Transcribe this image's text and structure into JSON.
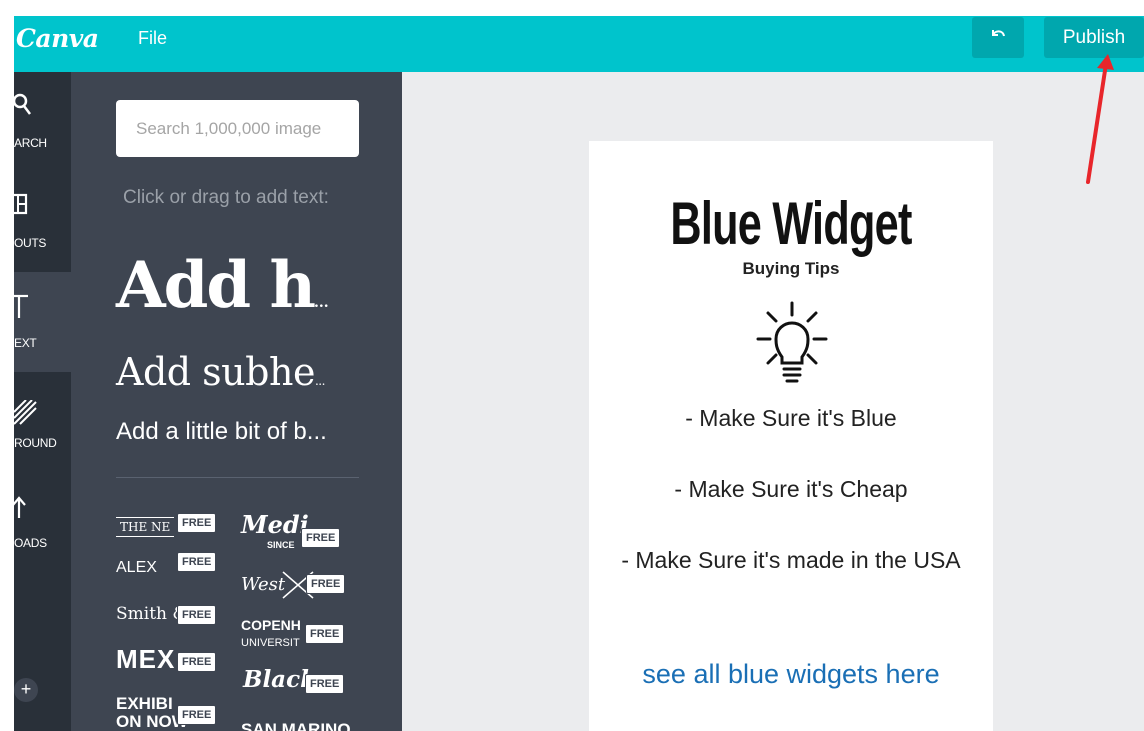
{
  "header": {
    "logo": "Canva",
    "file_menu": "File",
    "undo_icon": "undo-icon",
    "publish_label": "Publish"
  },
  "rail": {
    "items": [
      {
        "label": "ARCH",
        "icon": "search-icon"
      },
      {
        "label": "OUTS",
        "icon": "layouts-icon"
      },
      {
        "label": "EXT",
        "icon": "text-icon"
      },
      {
        "label": "ROUND",
        "icon": "background-icon"
      },
      {
        "label": "OADS",
        "icon": "upload-icon"
      }
    ],
    "active_index": 2,
    "plus_label": "+"
  },
  "panel": {
    "search_placeholder": "Search 1,000,000 image",
    "hint": "Click or drag to add text:",
    "add_heading": "Add h",
    "add_subheading": "Add subhe",
    "add_body": "Add a little bit of b...",
    "free_badge": "FREE",
    "templates": [
      "THE NE",
      "Medi",
      "SINCE",
      "ALEX",
      "West",
      "Smith &",
      "COPENH",
      "UNIVERSIT",
      "MEX",
      "Black",
      "EXHIBI",
      "ON NOW",
      "SAN MARINO"
    ]
  },
  "document": {
    "title": "Blue Widget",
    "subtitle": "Buying Tips",
    "tips": [
      "- Make Sure it's Blue",
      "- Make Sure it's Cheap",
      "- Make Sure it's made in the USA"
    ],
    "link": "see all blue widgets here",
    "link_color": "#1a6fb5"
  },
  "colors": {
    "accent": "#00c4cc",
    "panel": "#3e4551",
    "rail": "#293039",
    "annotation": "#e8262b"
  }
}
